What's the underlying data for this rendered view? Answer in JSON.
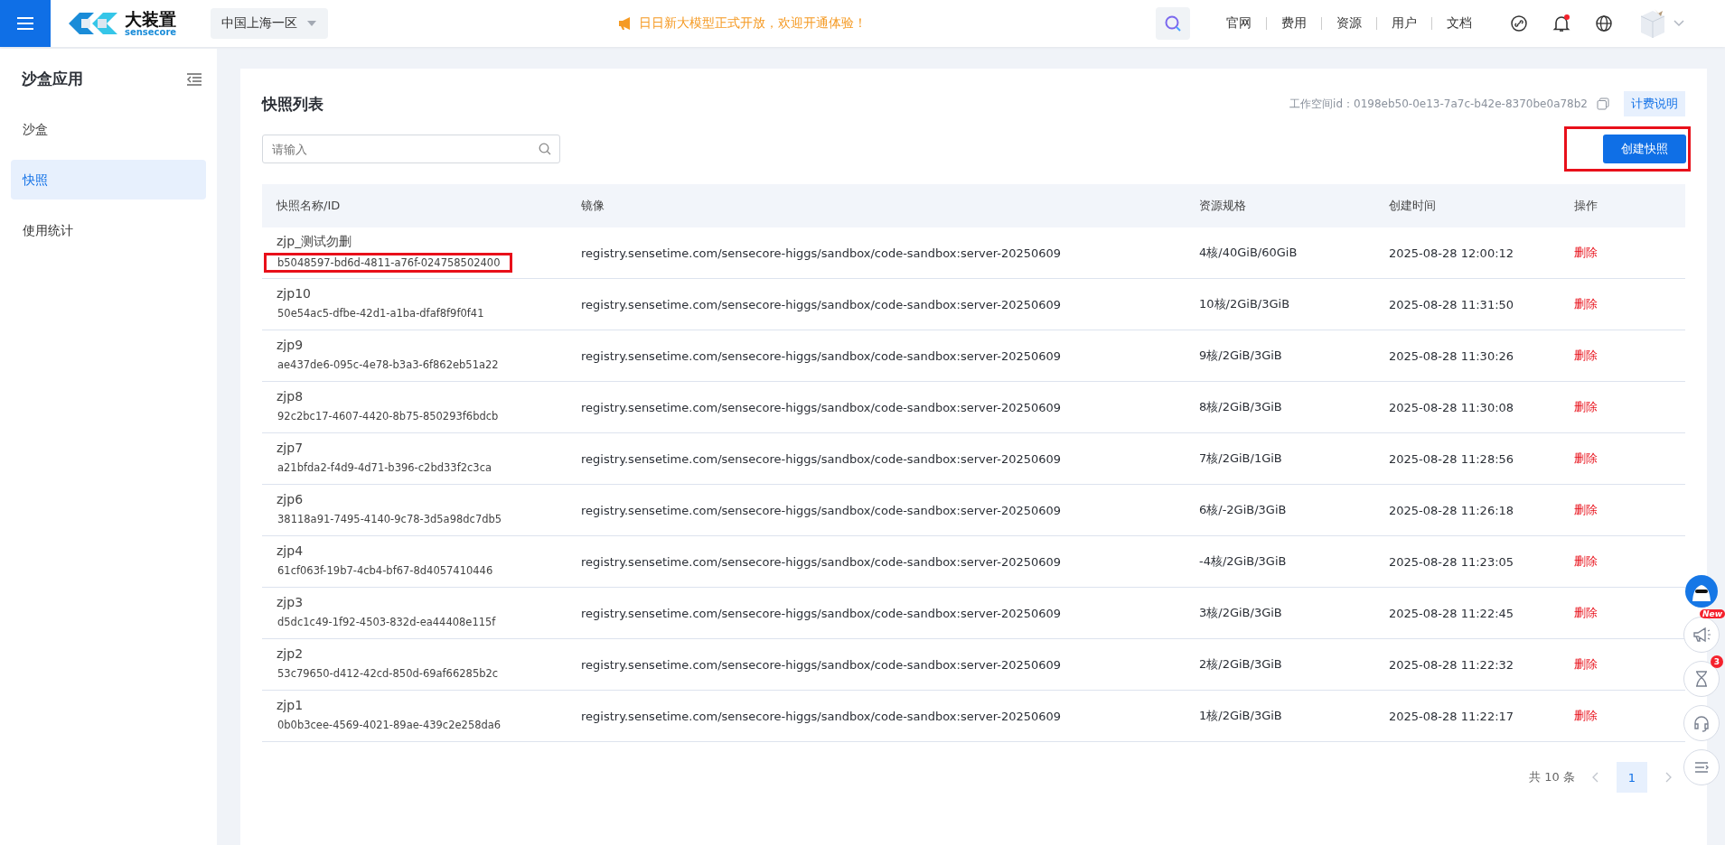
{
  "top_bar": {
    "brand": "大装置",
    "brand_sub": "sensecore",
    "region": "中国上海一区",
    "announcement": "日日新大模型正式开放，欢迎开通体验！",
    "nav_links": [
      "官网",
      "费用",
      "资源",
      "用户",
      "文档"
    ],
    "notifications": {
      "unread": true
    }
  },
  "sidebar": {
    "title": "沙盒应用",
    "items": [
      {
        "label": "沙盒",
        "selected": false
      },
      {
        "label": "快照",
        "selected": true
      },
      {
        "label": "使用统计",
        "selected": false
      }
    ]
  },
  "page": {
    "title": "快照列表",
    "workspace": "工作空间id：0198eb50-0e13-7a7c-b42e-8370be0a78b2",
    "billing_button": "计费说明",
    "search": {
      "placeholder": "请输入"
    },
    "create_button": {
      "label": "创建快照",
      "highlighted": true
    }
  },
  "table": {
    "columns": [
      "快照名称/ID",
      "镜像",
      "资源规格",
      "创建时间",
      "操作"
    ],
    "rows": [
      {
        "name": "zjp_测试勿删",
        "id": "b5048597-bd6d-4811-a76f-024758502400",
        "id_highlighted": true,
        "image": "registry.sensetime.com/sensecore-higgs/sandbox/code-sandbox:server-20250609",
        "spec": "4核/40GiB/60GiB",
        "created": "2025-08-28 12:00:12",
        "action": "删除"
      },
      {
        "name": "zjp10",
        "id": "50e54ac5-dfbe-42d1-a1ba-dfaf8f9f0f41",
        "id_highlighted": false,
        "image": "registry.sensetime.com/sensecore-higgs/sandbox/code-sandbox:server-20250609",
        "spec": "10核/2GiB/3GiB",
        "created": "2025-08-28 11:31:50",
        "action": "删除"
      },
      {
        "name": "zjp9",
        "id": "ae437de6-095c-4e78-b3a3-6f862eb51a22",
        "id_highlighted": false,
        "image": "registry.sensetime.com/sensecore-higgs/sandbox/code-sandbox:server-20250609",
        "spec": "9核/2GiB/3GiB",
        "created": "2025-08-28 11:30:26",
        "action": "删除"
      },
      {
        "name": "zjp8",
        "id": "92c2bc17-4607-4420-8b75-850293f6bdcb",
        "id_highlighted": false,
        "image": "registry.sensetime.com/sensecore-higgs/sandbox/code-sandbox:server-20250609",
        "spec": "8核/2GiB/3GiB",
        "created": "2025-08-28 11:30:08",
        "action": "删除"
      },
      {
        "name": "zjp7",
        "id": "a21bfda2-f4d9-4d71-b396-c2bd33f2c3ca",
        "id_highlighted": false,
        "image": "registry.sensetime.com/sensecore-higgs/sandbox/code-sandbox:server-20250609",
        "spec": "7核/2GiB/1GiB",
        "created": "2025-08-28 11:28:56",
        "action": "删除"
      },
      {
        "name": "zjp6",
        "id": "38118a91-7495-4140-9c78-3d5a98dc7db5",
        "id_highlighted": false,
        "image": "registry.sensetime.com/sensecore-higgs/sandbox/code-sandbox:server-20250609",
        "spec": "6核/-2GiB/3GiB",
        "created": "2025-08-28 11:26:18",
        "action": "删除"
      },
      {
        "name": "zjp4",
        "id": "61cf063f-19b7-4cb4-bf67-8d4057410446",
        "id_highlighted": false,
        "image": "registry.sensetime.com/sensecore-higgs/sandbox/code-sandbox:server-20250609",
        "spec": "-4核/2GiB/3GiB",
        "created": "2025-08-28 11:23:05",
        "action": "删除"
      },
      {
        "name": "zjp3",
        "id": "d5dc1c49-1f92-4503-832d-ea44408e115f",
        "id_highlighted": false,
        "image": "registry.sensetime.com/sensecore-higgs/sandbox/code-sandbox:server-20250609",
        "spec": "3核/2GiB/3GiB",
        "created": "2025-08-28 11:22:45",
        "action": "删除"
      },
      {
        "name": "zjp2",
        "id": "53c79650-d412-42cd-850d-69af66285b2c",
        "id_highlighted": false,
        "image": "registry.sensetime.com/sensecore-higgs/sandbox/code-sandbox:server-20250609",
        "spec": "2核/2GiB/3GiB",
        "created": "2025-08-28 11:22:32",
        "action": "删除"
      },
      {
        "name": "zjp1",
        "id": "0b0b3cee-4569-4021-89ae-439c2e258da6",
        "id_highlighted": false,
        "image": "registry.sensetime.com/sensecore-higgs/sandbox/code-sandbox:server-20250609",
        "spec": "1核/2GiB/3GiB",
        "created": "2025-08-28 11:22:17",
        "action": "删除"
      }
    ]
  },
  "pagination": {
    "total": "共 10 条",
    "pages": [
      {
        "label": "1",
        "selected": true
      }
    ]
  },
  "side_rail": {
    "new_badge": "New",
    "count_badge": "3"
  }
}
